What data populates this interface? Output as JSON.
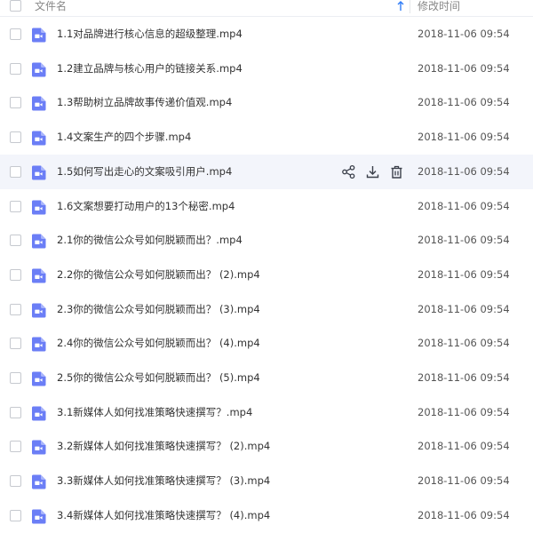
{
  "header": {
    "name_label": "文件名",
    "time_label": "修改时间",
    "sort_icon": "arrow-up-icon"
  },
  "colors": {
    "video_icon": "#6b7ef6",
    "hover_row": "#f3f5fb",
    "sort_arrow": "#2f7cf6",
    "action_icon": "#3a3f4a"
  },
  "rows": [
    {
      "name": "1.1对品牌进行核心信息的超级整理.mp4",
      "time": "2018-11-06 09:54"
    },
    {
      "name": "1.2建立品牌与核心用户的链接关系.mp4",
      "time": "2018-11-06 09:54"
    },
    {
      "name": "1.3帮助树立品牌故事传递价值观.mp4",
      "time": "2018-11-06 09:54"
    },
    {
      "name": "1.4文案生产的四个步骤.mp4",
      "time": "2018-11-06 09:54"
    },
    {
      "name": "1.5如何写出走心的文案吸引用户.mp4",
      "time": "2018-11-06 09:54",
      "hover": true
    },
    {
      "name": "1.6文案想要打动用户的13个秘密.mp4",
      "time": "2018-11-06 09:54"
    },
    {
      "name": "2.1你的微信公众号如何脱颖而出？.mp4",
      "time": "2018-11-06 09:54"
    },
    {
      "name": "2.2你的微信公众号如何脱颖而出？ (2).mp4",
      "time": "2018-11-06 09:54"
    },
    {
      "name": "2.3你的微信公众号如何脱颖而出？ (3).mp4",
      "time": "2018-11-06 09:54"
    },
    {
      "name": "2.4你的微信公众号如何脱颖而出？ (4).mp4",
      "time": "2018-11-06 09:54"
    },
    {
      "name": "2.5你的微信公众号如何脱颖而出？ (5).mp4",
      "time": "2018-11-06 09:54"
    },
    {
      "name": "3.1新媒体人如何找准策略快速撰写？.mp4",
      "time": "2018-11-06 09:54"
    },
    {
      "name": "3.2新媒体人如何找准策略快速撰写？ (2).mp4",
      "time": "2018-11-06 09:54"
    },
    {
      "name": "3.3新媒体人如何找准策略快速撰写？ (3).mp4",
      "time": "2018-11-06 09:54"
    },
    {
      "name": "3.4新媒体人如何找准策略快速撰写？ (4).mp4",
      "time": "2018-11-06 09:54"
    }
  ],
  "row_icons": {
    "file": "video-file-icon",
    "actions": [
      "share-icon",
      "download-icon",
      "delete-icon"
    ]
  }
}
